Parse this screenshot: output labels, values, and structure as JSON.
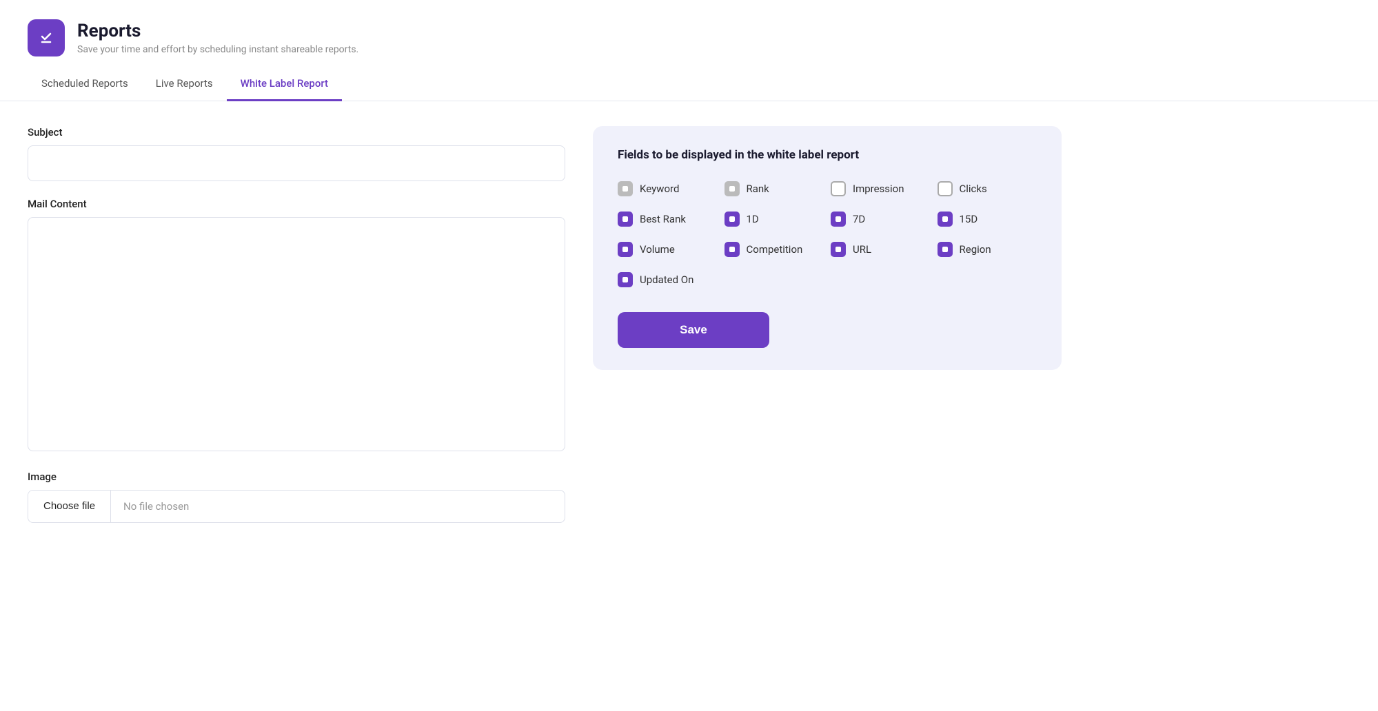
{
  "header": {
    "title": "Reports",
    "subtitle": "Save your time and effort by scheduling instant shareable reports.",
    "logo_alt": "reports-logo"
  },
  "tabs": [
    {
      "id": "scheduled",
      "label": "Scheduled Reports",
      "active": false
    },
    {
      "id": "live",
      "label": "Live Reports",
      "active": false
    },
    {
      "id": "whitelabel",
      "label": "White Label Report",
      "active": true
    }
  ],
  "form": {
    "subject_label": "Subject",
    "subject_placeholder": "",
    "mail_content_label": "Mail Content",
    "mail_content_placeholder": "",
    "image_label": "Image",
    "choose_file_label": "Choose file",
    "no_file_text": "No file chosen"
  },
  "fields_panel": {
    "title": "Fields to be displayed in the white label report",
    "fields": [
      {
        "id": "keyword",
        "label": "Keyword",
        "state": "gray",
        "checked": true
      },
      {
        "id": "rank",
        "label": "Rank",
        "state": "gray",
        "checked": true
      },
      {
        "id": "impression",
        "label": "Impression",
        "state": "unchecked",
        "checked": false
      },
      {
        "id": "clicks",
        "label": "Clicks",
        "state": "unchecked",
        "checked": false
      },
      {
        "id": "best_rank",
        "label": "Best Rank",
        "state": "purple",
        "checked": true
      },
      {
        "id": "1d",
        "label": "1D",
        "state": "purple",
        "checked": true
      },
      {
        "id": "7d",
        "label": "7D",
        "state": "purple",
        "checked": true
      },
      {
        "id": "15d",
        "label": "15D",
        "state": "purple",
        "checked": true
      },
      {
        "id": "volume",
        "label": "Volume",
        "state": "purple",
        "checked": true
      },
      {
        "id": "competition",
        "label": "Competition",
        "state": "purple",
        "checked": true
      },
      {
        "id": "url",
        "label": "URL",
        "state": "purple",
        "checked": true
      },
      {
        "id": "region",
        "label": "Region",
        "state": "purple",
        "checked": true
      },
      {
        "id": "updated_on",
        "label": "Updated On",
        "state": "purple",
        "checked": true
      }
    ],
    "save_label": "Save"
  }
}
